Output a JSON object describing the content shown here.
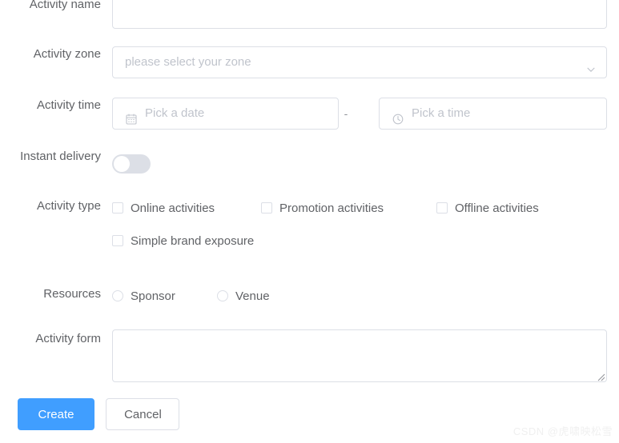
{
  "form": {
    "fields": {
      "activity_name": {
        "label": "Activity name",
        "value": "",
        "placeholder": ""
      },
      "activity_zone": {
        "label": "Activity zone",
        "value": "",
        "placeholder": "please select your zone",
        "caret_icon": "chevron-down-icon"
      },
      "activity_time": {
        "label": "Activity time",
        "date_placeholder": "Pick a date",
        "date_value": "",
        "date_icon": "calendar-icon",
        "separator": "-",
        "time_placeholder": "Pick a time",
        "time_value": "",
        "time_icon": "clock-icon"
      },
      "instant_delivery": {
        "label": "Instant delivery",
        "checked": false,
        "state_text": "off"
      },
      "activity_type": {
        "label": "Activity type",
        "options": [
          {
            "label": "Online activities",
            "checked": false
          },
          {
            "label": "Promotion activities",
            "checked": false
          },
          {
            "label": "Offline activities",
            "checked": false
          },
          {
            "label": "Simple brand exposure",
            "checked": false
          }
        ]
      },
      "resources": {
        "label": "Resources",
        "options": [
          {
            "label": "Sponsor",
            "checked": false
          },
          {
            "label": "Venue",
            "checked": false
          }
        ]
      },
      "activity_form": {
        "label": "Activity form",
        "value": "",
        "placeholder": ""
      }
    },
    "actions": {
      "submit_label": "Create",
      "cancel_label": "Cancel"
    }
  },
  "watermark": {
    "text": "CSDN @虎啸映松雪",
    "ghost_text": ""
  },
  "colors": {
    "primary": "#409eff",
    "border": "#dcdfe6",
    "label_text": "#606266",
    "placeholder_text": "#c0c4cc",
    "switch_off": "#dcdfe6"
  }
}
